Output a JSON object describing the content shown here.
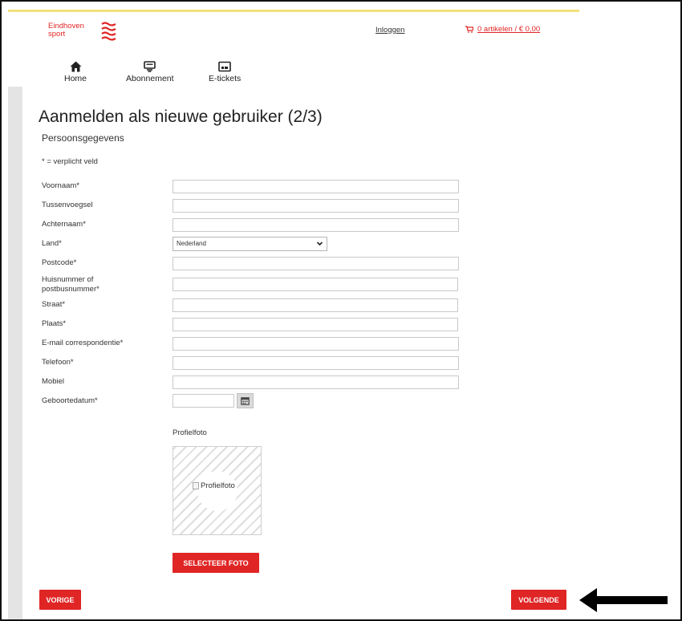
{
  "header": {
    "logo_line1": "Eindhoven",
    "logo_line2": "sport",
    "login_label": "Inloggen",
    "cart_label": "0 artikelen / € 0,00"
  },
  "nav": {
    "items": [
      {
        "label": "Home",
        "icon": "home-icon"
      },
      {
        "label": "Abonnement",
        "icon": "subscription-icon"
      },
      {
        "label": "E-tickets",
        "icon": "ticket-icon"
      }
    ]
  },
  "page": {
    "title": "Aanmelden als nieuwe gebruiker (2/3)",
    "section": "Persoonsgegevens",
    "required_note": "* = verplicht veld"
  },
  "form": {
    "fields": [
      {
        "label": "Voornaam*",
        "value": ""
      },
      {
        "label": "Tussenvoegsel",
        "value": ""
      },
      {
        "label": "Achternaam*",
        "value": ""
      },
      {
        "label": "Land*",
        "value": "Nederland"
      },
      {
        "label": "Postcode*",
        "value": ""
      },
      {
        "label": "Huisnummer of postbusnummer*",
        "value": ""
      },
      {
        "label": "Straat*",
        "value": ""
      },
      {
        "label": "Plaats*",
        "value": ""
      },
      {
        "label": "E-mail correspondentie*",
        "value": ""
      },
      {
        "label": "Telefoon*",
        "value": ""
      },
      {
        "label": "Mobiel",
        "value": ""
      },
      {
        "label": "Geboortedatum*",
        "value": ""
      }
    ],
    "photo_label": "Profielfoto",
    "photo_alt": "Profielfoto",
    "select_photo_button": "SELECTEER FOTO"
  },
  "footer": {
    "prev_button": "VORIGE",
    "next_button": "VOLGENDE"
  },
  "colors": {
    "accent": "#e02525",
    "header_line": "#f5e17a"
  }
}
